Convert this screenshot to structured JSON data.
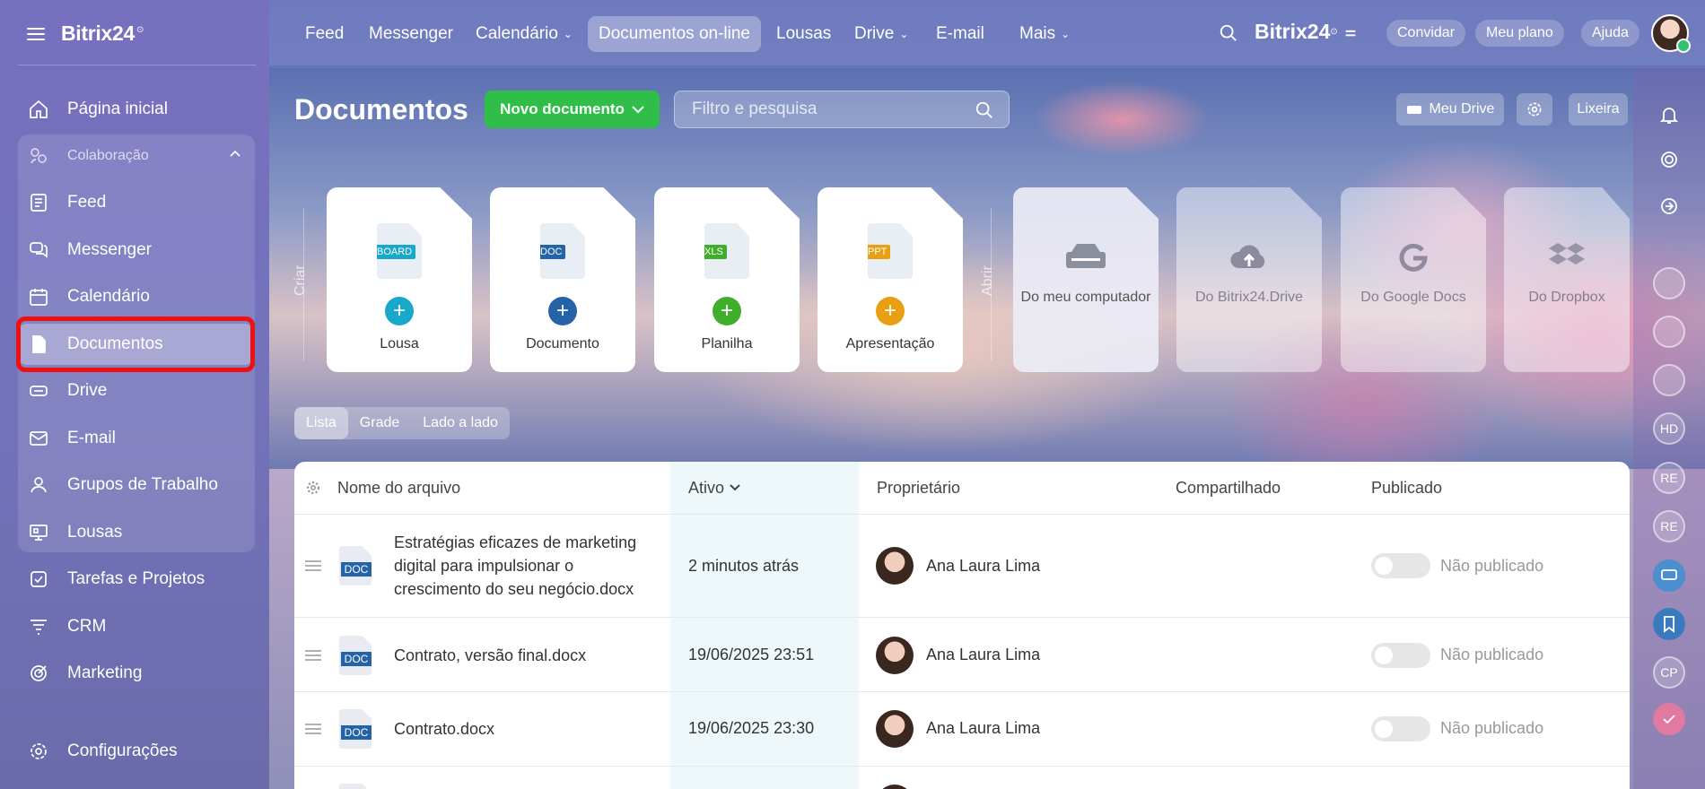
{
  "app": {
    "brand": "Bitrix24",
    "brand_mark": "⊙"
  },
  "sidebar": {
    "home": "Página inicial",
    "group_title": "Colaboração",
    "group_items": [
      {
        "label": "Feed",
        "icon": "feed-icon"
      },
      {
        "label": "Messenger",
        "icon": "chat-icon"
      },
      {
        "label": "Calendário",
        "icon": "calendar-icon"
      },
      {
        "label": "Documentos",
        "icon": "document-icon",
        "active": true
      },
      {
        "label": "Drive",
        "icon": "drive-icon"
      },
      {
        "label": "E-mail",
        "icon": "mail-icon"
      },
      {
        "label": "Grupos de Trabalho",
        "icon": "groups-icon"
      },
      {
        "label": "Lousas",
        "icon": "board-icon"
      }
    ],
    "items": [
      {
        "label": "Tarefas e Projetos",
        "icon": "tasks-icon"
      },
      {
        "label": "CRM",
        "icon": "crm-icon"
      },
      {
        "label": "Marketing",
        "icon": "marketing-icon"
      }
    ],
    "settings": "Configurações"
  },
  "topnav": {
    "items": [
      {
        "label": "Feed"
      },
      {
        "label": "Messenger"
      },
      {
        "label": "Calendário",
        "dropdown": true
      },
      {
        "label": "Documentos on-line",
        "active": true
      },
      {
        "label": "Lousas"
      },
      {
        "label": "Drive",
        "dropdown": true
      },
      {
        "label": "E-mail"
      },
      {
        "label": "Mais",
        "dropdown": true
      }
    ],
    "brand": "Bitrix24",
    "invite": "Convidar",
    "plan": "Meu plano",
    "help": "Ajuda"
  },
  "page": {
    "title": "Documentos",
    "new_doc": "Novo documento",
    "search_placeholder": "Filtro e pesquisa",
    "my_drive": "Meu Drive",
    "trash": "Lixeira"
  },
  "create": {
    "label": "Criar",
    "cards": [
      {
        "label": "Lousa",
        "tag": "BOARD",
        "tag_color": "#19a8c9",
        "plus_color": "#19a8c9"
      },
      {
        "label": "Documento",
        "tag": "DOC",
        "tag_color": "#2563a8",
        "plus_color": "#2563a8"
      },
      {
        "label": "Planilha",
        "tag": "XLS",
        "tag_color": "#3fae2a",
        "plus_color": "#3fae2a"
      },
      {
        "label": "Apresentação",
        "tag": "PPT",
        "tag_color": "#e8a012",
        "plus_color": "#e8a012"
      }
    ]
  },
  "open": {
    "label": "Abrir",
    "cards": [
      {
        "label": "Do meu computador",
        "icon": "computer-drive-icon"
      },
      {
        "label": "Do Bitrix24.Drive",
        "icon": "cloud-upload-icon"
      },
      {
        "label": "Do Google Docs",
        "icon": "google-icon"
      },
      {
        "label": "Do Dropbox",
        "icon": "dropbox-icon"
      }
    ]
  },
  "views": [
    "Lista",
    "Grade",
    "Lado a lado"
  ],
  "table": {
    "columns": {
      "name": "Nome do arquivo",
      "active": "Ativo",
      "owner": "Proprietário",
      "shared": "Compartilhado",
      "published": "Publicado"
    },
    "rows": [
      {
        "name": "Estratégias eficazes de marketing digital para impulsionar o crescimento do seu negócio.docx",
        "active": "2 minutos atrás",
        "owner": "Ana Laura Lima",
        "published": "Não publicado"
      },
      {
        "name": "Contrato, versão final.docx",
        "active": "19/06/2025 23:51",
        "owner": "Ana Laura Lima",
        "published": "Não publicado"
      },
      {
        "name": "Contrato.docx",
        "active": "19/06/2025 23:30",
        "owner": "Ana Laura Lima",
        "published": "Não publicado"
      }
    ]
  },
  "rightbar": {
    "avatars": [
      "HD",
      "RE",
      "RE",
      "CP"
    ]
  },
  "colors": {
    "accent_green": "#2fbf49",
    "highlight_red": "#e11111",
    "doc_blue": "#2563a8"
  }
}
